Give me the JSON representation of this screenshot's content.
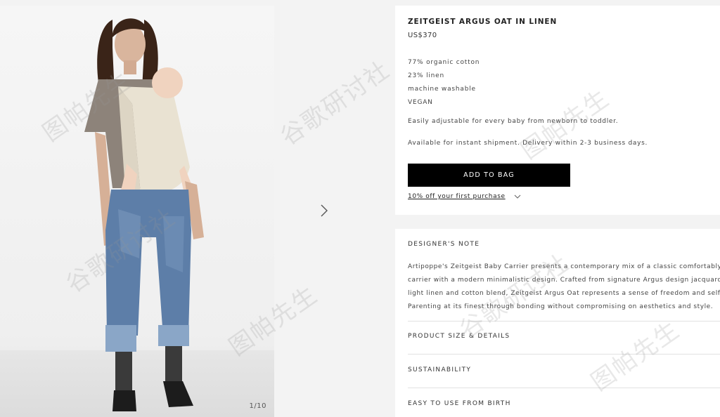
{
  "gallery": {
    "counter": "1/10",
    "next_icon": "chevron-right-icon"
  },
  "product": {
    "title": "ZEITGEIST ARGUS OAT IN LINEN",
    "price": "US$370",
    "specs": [
      "77% organic cotton",
      "23% linen",
      "machine washable",
      "VEGAN"
    ],
    "description": "Easily adjustable for every baby from newborn to toddler.",
    "availability": "Available for instant shipment. Delivery within 2-3 business days.",
    "add_to_bag_label": "ADD TO BAG",
    "promo_text": "10% off your first purchase",
    "promo_icon": "chevron-down-icon"
  },
  "designer_note": {
    "heading": "DESIGNER'S NOTE",
    "lines": [
      "Artipoppe's Zeitgeist Baby Carrier presents a contemporary mix of a classic comfortably st",
      "carrier with a modern minimalistic design. Crafted from signature Argus design jacquard w",
      "light linen and cotton blend, Zeitgeist Argus Oat represents a sense of freedom and self-e",
      "Parenting at its finest through bonding without compromising on aesthetics and style."
    ]
  },
  "accordion": {
    "size_details": "PRODUCT SIZE & DETAILS",
    "sustainability": "SUSTAINABILITY",
    "easy_to_use": "EASY TO USE FROM BIRTH"
  },
  "watermark": {
    "text_a": "图帕先生",
    "text_b": "谷歌研讨社"
  },
  "colors": {
    "background": "#f3f3f3",
    "card": "#ffffff",
    "button": "#000000",
    "button_text": "#ffffff"
  }
}
